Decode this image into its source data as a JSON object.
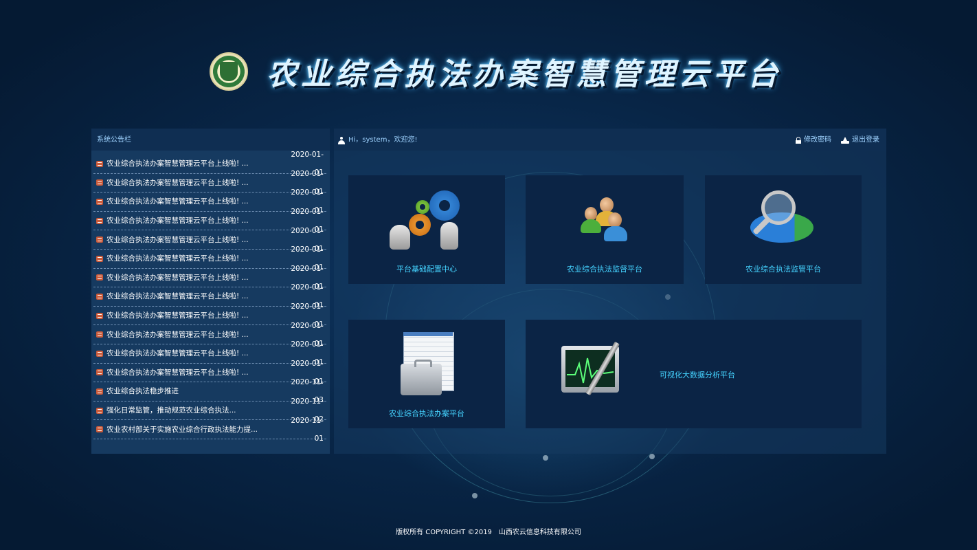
{
  "header": {
    "title": "农业综合执法办案智慧管理云平台"
  },
  "notice_panel": {
    "title": "系统公告栏",
    "items": [
      {
        "text": "农业综合执法办案智慧管理云平台上线啦! ...",
        "date": "2020-01-01"
      },
      {
        "text": "农业综合执法办案智慧管理云平台上线啦! ...",
        "date": "2020-01-01"
      },
      {
        "text": "农业综合执法办案智慧管理云平台上线啦! ...",
        "date": "2020-01-01"
      },
      {
        "text": "农业综合执法办案智慧管理云平台上线啦! ...",
        "date": "2020-01-01"
      },
      {
        "text": "农业综合执法办案智慧管理云平台上线啦! ...",
        "date": "2020-01-01"
      },
      {
        "text": "农业综合执法办案智慧管理云平台上线啦! ...",
        "date": "2020-01-01"
      },
      {
        "text": "农业综合执法办案智慧管理云平台上线啦! ...",
        "date": "2020-01-01"
      },
      {
        "text": "农业综合执法办案智慧管理云平台上线啦! ...",
        "date": "2020-01-01"
      },
      {
        "text": "农业综合执法办案智慧管理云平台上线啦! ...",
        "date": "2020-01-01"
      },
      {
        "text": "农业综合执法办案智慧管理云平台上线啦! ...",
        "date": "2020-01-01"
      },
      {
        "text": "农业综合执法办案智慧管理云平台上线啦! ...",
        "date": "2020-01-01"
      },
      {
        "text": "农业综合执法办案智慧管理云平台上线啦! ...",
        "date": "2020-01-01"
      },
      {
        "text": "农业综合执法稳步推进",
        "date": "2020-11-03"
      },
      {
        "text": "强化日常监管，推动规范农业综合执法...",
        "date": "2020-11-02"
      },
      {
        "text": "农业农村部关于实施农业综合行政执法能力提...",
        "date": "2020-11-01"
      }
    ]
  },
  "user_bar": {
    "greeting": "Hi，system，欢迎您!",
    "change_password": "修改密码",
    "logout": "退出登录"
  },
  "tiles": [
    {
      "label": "平台基础配置中心",
      "icon": "gears-icon"
    },
    {
      "label": "农业综合执法监督平台",
      "icon": "users-icon"
    },
    {
      "label": "农业综合执法监管平台",
      "icon": "pie-magnifier-icon"
    },
    {
      "label": "农业综合执法办案平台",
      "icon": "toolbox-spreadsheet-icon"
    },
    {
      "label": "可视化大数据分析平台",
      "icon": "monitor-chart-icon"
    }
  ],
  "footer": {
    "copyright": "版权所有 COPYRIGHT ©2019　山西农云信息科技有限公司"
  },
  "colors": {
    "background": "#082546",
    "panel": "#163a60",
    "tile": "#0b2445",
    "accent": "#45d3ff"
  }
}
